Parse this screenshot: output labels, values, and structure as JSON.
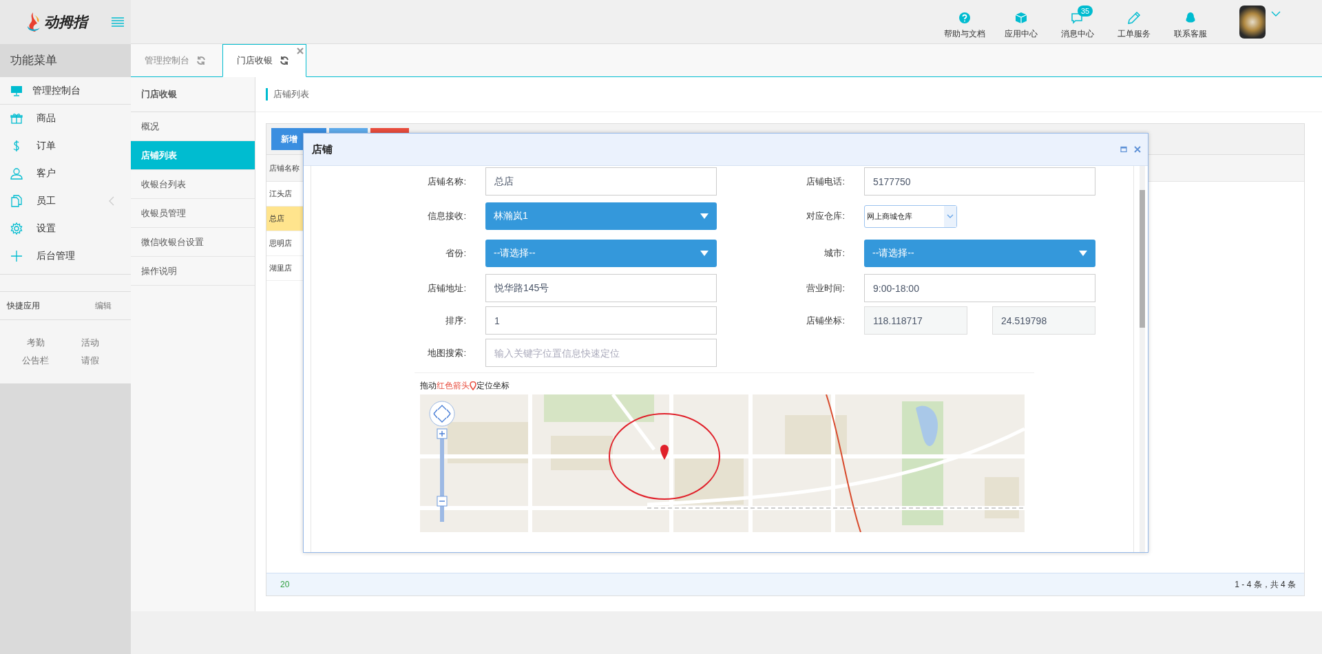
{
  "header": {
    "logo_text": "动拇指",
    "nav": [
      {
        "label": "帮助与文档"
      },
      {
        "label": "应用中心"
      },
      {
        "label": "消息中心",
        "badge": "35"
      },
      {
        "label": "工单服务"
      },
      {
        "label": "联系客服"
      }
    ]
  },
  "sidebar": {
    "title": "功能菜单",
    "items": [
      {
        "label": "管理控制台",
        "has_submenu": false
      },
      {
        "label": "商品",
        "has_submenu": false
      },
      {
        "label": "订单",
        "has_submenu": false
      },
      {
        "label": "客户",
        "has_submenu": false
      },
      {
        "label": "员工",
        "has_submenu": true
      },
      {
        "label": "设置",
        "has_submenu": false
      },
      {
        "label": "后台管理",
        "has_submenu": false
      }
    ],
    "quick_apps": {
      "title": "快捷应用",
      "edit": "编辑",
      "apps": [
        "考勤",
        "活动",
        "公告栏",
        "请假"
      ]
    }
  },
  "tabs": [
    {
      "label": "管理控制台",
      "selected": false,
      "closable": false
    },
    {
      "label": "门店收银",
      "selected": true,
      "closable": true
    }
  ],
  "subnav": {
    "title": "门店收银",
    "items": [
      {
        "label": "概况",
        "selected": false
      },
      {
        "label": "店铺列表",
        "selected": true
      },
      {
        "label": "收银台列表",
        "selected": false
      },
      {
        "label": "收银员管理",
        "selected": false
      },
      {
        "label": "微信收银台设置",
        "selected": false
      },
      {
        "label": "操作说明",
        "selected": false
      }
    ]
  },
  "breadcrumb": "店铺列表",
  "table": {
    "toolbar_buttons": [
      {
        "kind": "primary",
        "label": "新增"
      },
      {
        "kind": "info"
      },
      {
        "kind": "danger"
      }
    ],
    "columns": [
      "店铺名称"
    ],
    "rows": [
      {
        "cells": [
          "江头店"
        ],
        "selected": false
      },
      {
        "cells": [
          "总店"
        ],
        "selected": true
      },
      {
        "cells": [
          "思明店"
        ],
        "selected": false
      },
      {
        "cells": [
          "湖里店"
        ],
        "selected": false
      }
    ],
    "pager": {
      "page_size": "20",
      "summary": "1 - 4 条，共 4 条"
    }
  },
  "modal": {
    "title": "店铺",
    "rows": [
      {
        "left": {
          "label": "店铺名称:",
          "controls": [
            {
              "kind": "input",
              "value": "总店",
              "readonly": false
            }
          ]
        },
        "right": {
          "label": "店铺电话:",
          "controls": [
            {
              "kind": "input",
              "value": "5177750",
              "readonly": false
            }
          ]
        }
      },
      {
        "left": {
          "label": "信息接收:",
          "controls": [
            {
              "kind": "select",
              "value": "林瀚岚1"
            }
          ]
        },
        "right": {
          "label": "对应仓库:",
          "controls": [
            {
              "kind": "dropdown",
              "value": "网上商城仓库"
            }
          ]
        }
      },
      {
        "left": {
          "label": "省份:",
          "controls": [
            {
              "kind": "select",
              "value": "--请选择--"
            }
          ]
        },
        "right": {
          "label": "城市:",
          "controls": [
            {
              "kind": "select",
              "value": "--请选择--"
            }
          ]
        }
      },
      {
        "left": {
          "label": "店铺地址:",
          "controls": [
            {
              "kind": "input",
              "value": "悦华路145号",
              "readonly": false
            }
          ]
        },
        "right": {
          "label": "营业时间:",
          "controls": [
            {
              "kind": "input",
              "value": "9:00-18:00",
              "readonly": false
            }
          ]
        }
      },
      {
        "left": {
          "label": "排序:",
          "controls": [
            {
              "kind": "input",
              "value": "1",
              "readonly": false
            }
          ]
        },
        "right": {
          "label": "店铺坐标:",
          "controls": [
            {
              "kind": "input",
              "value": "118.118717",
              "readonly": true
            },
            {
              "kind": "input",
              "value": "24.519798",
              "readonly": true
            }
          ]
        }
      },
      {
        "left": {
          "label": "地图搜索:",
          "controls": [
            {
              "kind": "input",
              "placeholder": "输入关键字位置信息快速定位",
              "readonly": false
            }
          ]
        }
      }
    ],
    "map_hint": {
      "before": "拖动",
      "highlight": "红色箭头",
      "after": "定位坐标"
    }
  }
}
